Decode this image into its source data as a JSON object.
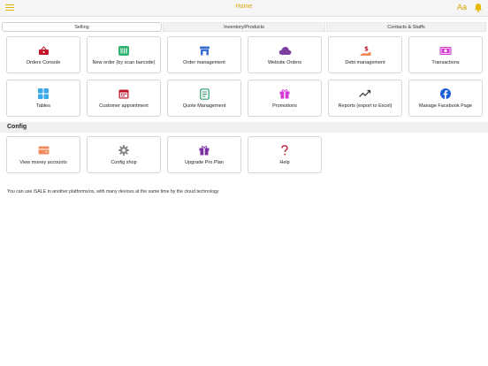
{
  "header": {
    "title": "Home",
    "font_label": "Aa"
  },
  "tabs": [
    {
      "label": "Selling"
    },
    {
      "label": "Inventory/Products"
    },
    {
      "label": "Contacts & Staffs"
    }
  ],
  "selling": {
    "row1": [
      {
        "label": "Orders Console",
        "icon": "basket-icon"
      },
      {
        "label": "New order (by scan barcode)",
        "icon": "barcode-icon"
      },
      {
        "label": "Order management",
        "icon": "store-icon"
      },
      {
        "label": "Website Orders",
        "icon": "cloud-icon"
      },
      {
        "label": "Debt management",
        "icon": "debt-icon"
      },
      {
        "label": "Transactions",
        "icon": "cash-icon"
      }
    ],
    "row2": [
      {
        "label": "Tables",
        "icon": "grid-icon"
      },
      {
        "label": "Customer appointment",
        "icon": "calendar-icon"
      },
      {
        "label": "Quote Management",
        "icon": "document-icon"
      },
      {
        "label": "Promotions",
        "icon": "gift-icon"
      },
      {
        "label": "Reports (export to Excel)",
        "icon": "trending-up-icon"
      },
      {
        "label": "Manage Facebook Page",
        "icon": "facebook-icon"
      }
    ]
  },
  "config": {
    "title": "Config",
    "items": [
      {
        "label": "View money accounts",
        "icon": "wallet-icon"
      },
      {
        "label": "Config shop",
        "icon": "gear-icon"
      },
      {
        "label": "Upgrade Pro Plan",
        "icon": "gift-icon"
      },
      {
        "label": "Help",
        "icon": "question-icon"
      }
    ]
  },
  "footer_note": "You can use iSALE in another platforms/os, with many devices at the same time by the cloud technology",
  "colors": {
    "accent": "#d7a700",
    "red": "#c0142a",
    "green": "#2bb56e",
    "blue": "#3b6fd1",
    "purple": "#7b3fa0",
    "magenta": "#d63ad6",
    "orange": "#f08a5d"
  }
}
